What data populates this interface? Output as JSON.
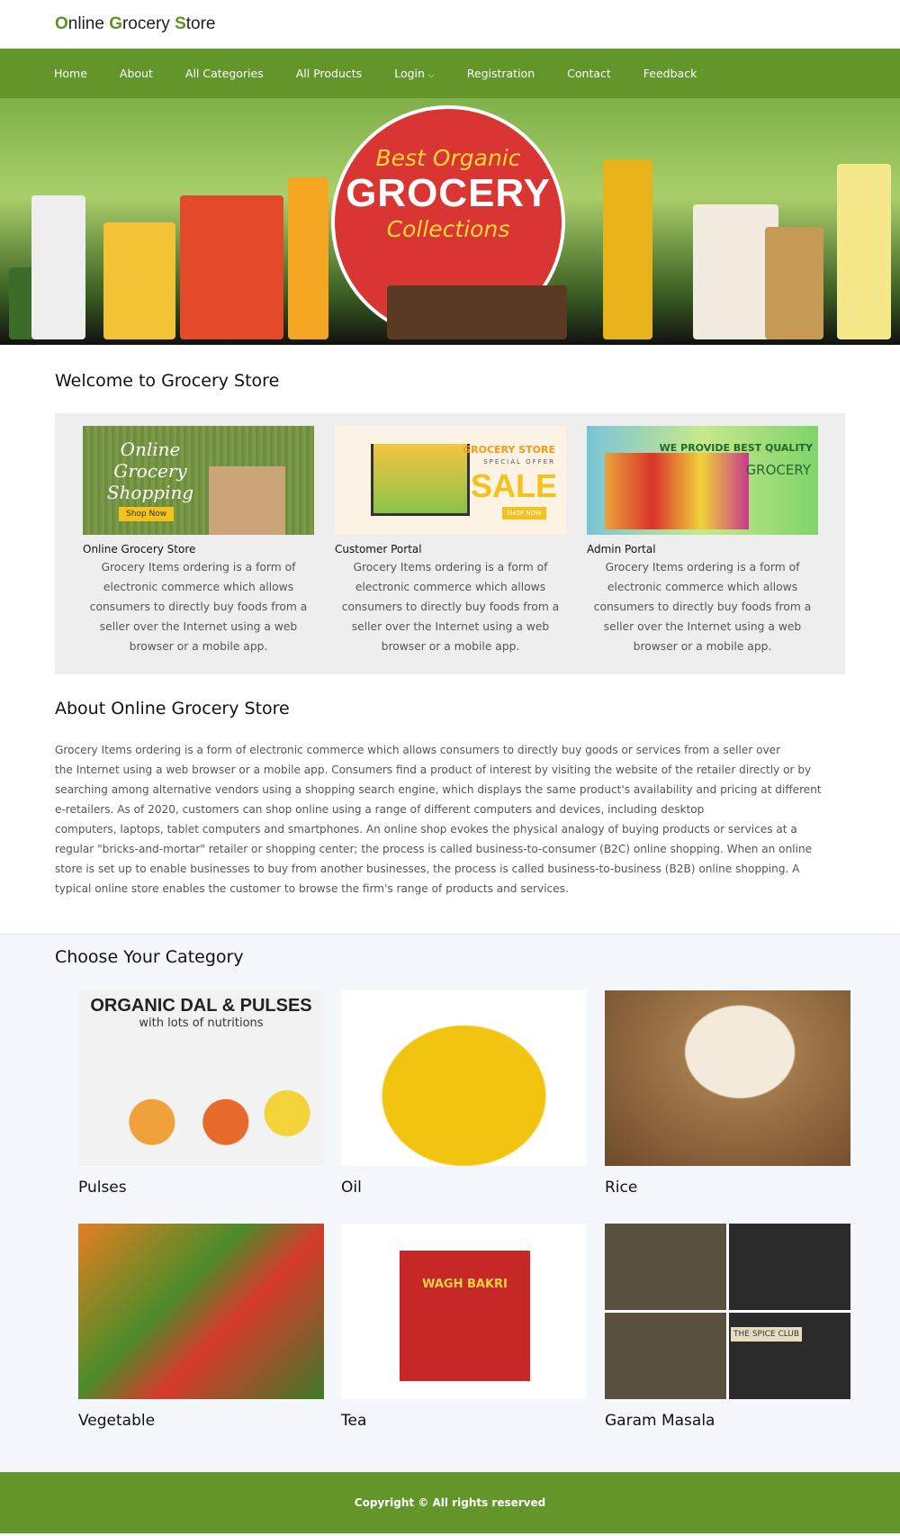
{
  "brand": {
    "parts": [
      {
        "initial": "O",
        "rest": "nline "
      },
      {
        "initial": "G",
        "rest": "rocery "
      },
      {
        "initial": "S",
        "rest": "tore"
      }
    ]
  },
  "nav": {
    "items": [
      "Home",
      "About",
      "All Categories",
      "All Products",
      "Login",
      "Registration",
      "Contact",
      "Feedback"
    ],
    "login_caret": "⌵"
  },
  "banner": {
    "line1": "Best Organic",
    "line2": "GROCERY",
    "line3": "Collections"
  },
  "welcome": {
    "title": "Welcome to Grocery Store",
    "cards": [
      {
        "title": "Online Grocery Store",
        "image_text": "Online Grocery Shopping",
        "image_button": "Shop Now",
        "desc": "Grocery Items ordering is a form of electronic commerce which allows consumers to directly buy foods from a seller over the Internet using a web browser or a mobile app."
      },
      {
        "title": "Customer Portal",
        "image_text": "GROCERY STORE",
        "image_sub": "SPECIAL OFFER",
        "image_big": "SALE",
        "image_button": "SHOP NOW",
        "desc": "Grocery Items ordering is a form of electronic commerce which allows consumers to directly buy foods from a seller over the Internet using a web browser or a mobile app."
      },
      {
        "title": "Admin Portal",
        "image_text": "WE PROVIDE BEST QUALITY",
        "image_sub": "GROCERY",
        "desc": "Grocery Items ordering is a form of electronic commerce which allows consumers to directly buy foods from a seller over the Internet using a web browser or a mobile app."
      }
    ]
  },
  "about": {
    "title": "About Online Grocery Store",
    "lines": [
      "Grocery Items ordering is a form of electronic commerce which allows consumers to directly buy goods or services from a seller over",
      "the Internet using a web browser or a mobile app. Consumers find a product of interest by visiting the website of the retailer directly or by",
      "searching among alternative vendors using a shopping search engine, which displays the same product's availability and pricing at different",
      "e-retailers. As of 2020, customers can shop online using a range of different computers and devices, including desktop",
      "computers, laptops, tablet computers and smartphones. An online shop evokes the physical analogy of buying products or services at a",
      "regular \"bricks-and-mortar\" retailer or shopping center; the process is called business-to-consumer (B2C) online shopping. When an online",
      "store is set up to enable businesses to buy from another businesses, the process is called business-to-business (B2B) online shopping. A",
      "typical online store enables the customer to browse the firm's range of products and services."
    ]
  },
  "categories": {
    "title": "Choose Your Category",
    "items": [
      {
        "label": "Pulses",
        "image_text": "ORGANIC DAL & PULSES",
        "image_sub": "with lots of nutritions"
      },
      {
        "label": "Oil"
      },
      {
        "label": "Rice"
      },
      {
        "label": "Vegetable"
      },
      {
        "label": "Tea",
        "image_text": "WAGH BAKRI"
      },
      {
        "label": "Garam Masala",
        "image_text": "THE SPICE CLUB"
      }
    ]
  },
  "footer": {
    "text": "Copyright © All rights reserved"
  },
  "colors": {
    "brand_green": "#62962a",
    "panel_gray": "#eeeeee"
  }
}
